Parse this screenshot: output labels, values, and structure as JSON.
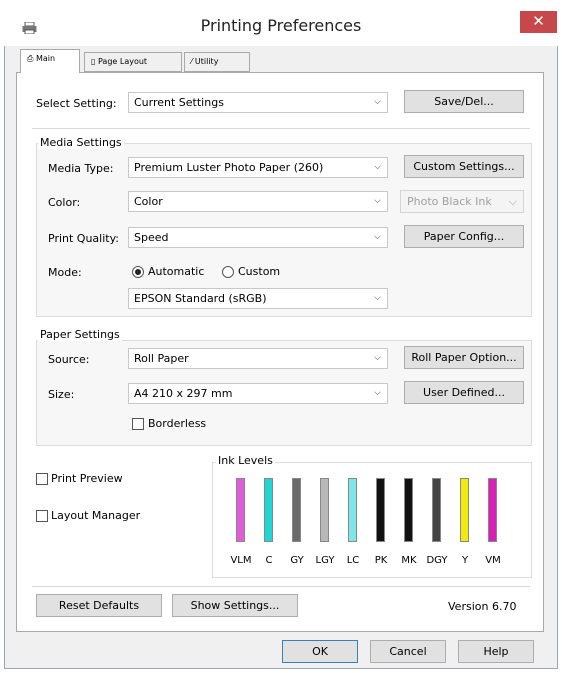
{
  "window": {
    "title": "Printing Preferences",
    "close_glyph": "✕"
  },
  "tabs": [
    {
      "label": "Main",
      "icon": "printer-icon"
    },
    {
      "label": "Page Layout",
      "icon": "page-icon"
    },
    {
      "label": "Utility",
      "icon": "wrench-icon"
    }
  ],
  "select_setting": {
    "label": "Select Setting:",
    "value": "Current Settings",
    "button": "Save/Del..."
  },
  "media_settings": {
    "title": "Media Settings",
    "media_type": {
      "label": "Media Type:",
      "value": "Premium Luster Photo Paper (260)",
      "button": "Custom Settings..."
    },
    "color": {
      "label": "Color:",
      "value": "Color",
      "ink_value": "Photo Black Ink"
    },
    "print_quality": {
      "label": "Print Quality:",
      "value": "Speed",
      "button": "Paper Config..."
    },
    "mode": {
      "label": "Mode:",
      "automatic": "Automatic",
      "custom": "Custom",
      "selected": "Automatic",
      "preset": "EPSON Standard (sRGB)"
    }
  },
  "paper_settings": {
    "title": "Paper Settings",
    "source": {
      "label": "Source:",
      "value": "Roll Paper",
      "button": "Roll Paper Option..."
    },
    "size": {
      "label": "Size:",
      "value": "A4 210 x 297 mm",
      "button": "User Defined..."
    },
    "borderless": {
      "label": "Borderless",
      "checked": false
    }
  },
  "options": {
    "print_preview": {
      "label": "Print Preview",
      "checked": false
    },
    "layout_manager": {
      "label": "Layout Manager",
      "checked": false
    }
  },
  "ink_levels": {
    "title": "Ink Levels",
    "inks": [
      {
        "name": "VLM",
        "color": "#e05cd8",
        "level": 1.0
      },
      {
        "name": "C",
        "color": "#1fd6d6",
        "level": 1.0
      },
      {
        "name": "GY",
        "color": "#6a6a6a",
        "level": 1.0
      },
      {
        "name": "LGY",
        "color": "#b8b8b8",
        "level": 1.0
      },
      {
        "name": "LC",
        "color": "#7ee8e8",
        "level": 1.0
      },
      {
        "name": "PK",
        "color": "#111111",
        "level": 1.0
      },
      {
        "name": "MK",
        "color": "#111111",
        "level": 1.0
      },
      {
        "name": "DGY",
        "color": "#444444",
        "level": 1.0
      },
      {
        "name": "Y",
        "color": "#f2ea0a",
        "level": 1.0
      },
      {
        "name": "VM",
        "color": "#d820b8",
        "level": 1.0
      }
    ]
  },
  "bottom": {
    "reset": "Reset Defaults",
    "show_settings": "Show Settings...",
    "version": "Version 6.70"
  },
  "dialog_buttons": {
    "ok": "OK",
    "cancel": "Cancel",
    "help": "Help"
  }
}
